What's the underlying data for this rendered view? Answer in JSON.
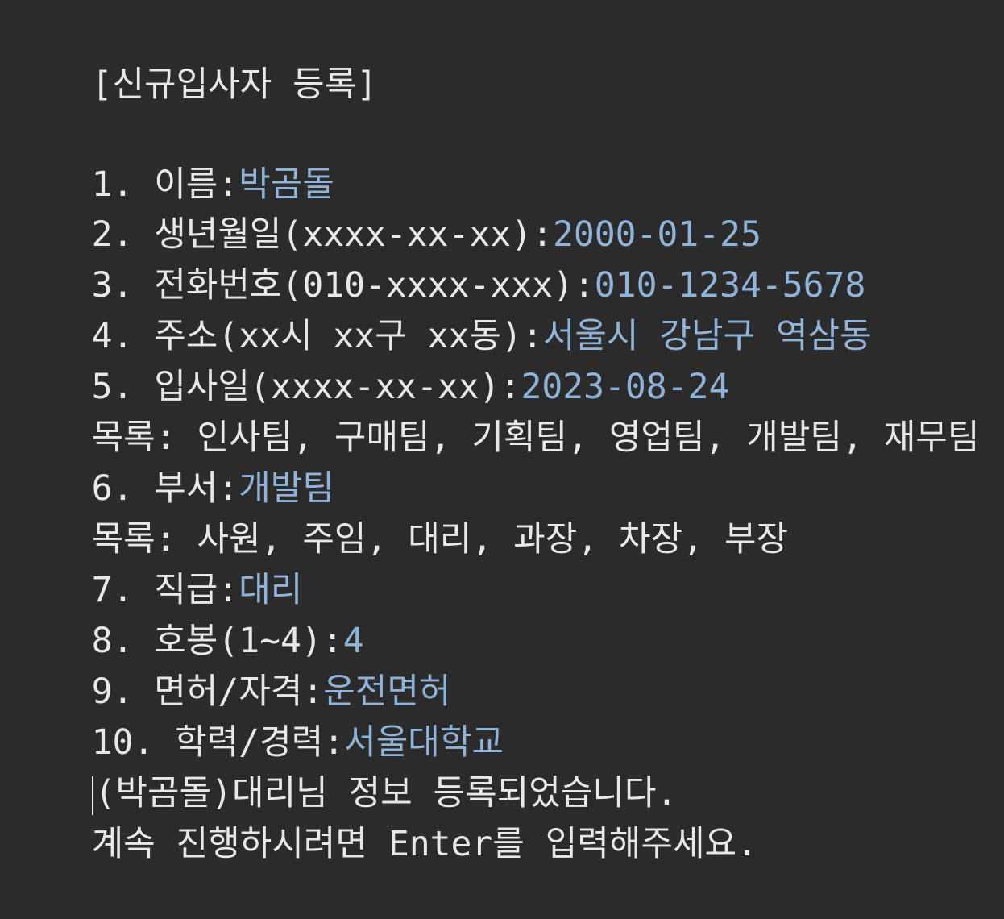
{
  "console": {
    "title": "[신규입사자 등록]",
    "fields": [
      {
        "prompt": "1. 이름:",
        "value": "박곰돌"
      },
      {
        "prompt": "2. 생년월일(xxxx-xx-xx):",
        "value": "2000-01-25"
      },
      {
        "prompt": "3. 전화번호(010-xxxx-xxx):",
        "value": "010-1234-5678"
      },
      {
        "prompt": "4. 주소(xx시 xx구 xx동):",
        "value": "서울시 강남구 역삼동"
      },
      {
        "prompt": "5. 입사일(xxxx-xx-xx):",
        "value": "2023-08-24"
      }
    ],
    "dept_list": "목록: 인사팀, 구매팀, 기획팀, 영업팀, 개발팀, 재무팀",
    "dept_field": {
      "prompt": "6. 부서:",
      "value": "개발팀"
    },
    "rank_list": "목록: 사원, 주임, 대리, 과장, 차장, 부장",
    "fields2": [
      {
        "prompt": "7. 직급:",
        "value": "대리"
      },
      {
        "prompt": "8. 호봉(1~4):",
        "value": "4"
      },
      {
        "prompt": "9. 면허/자격:",
        "value": "운전면허"
      },
      {
        "prompt": "10. 학력/경력:",
        "value": "서울대학교"
      }
    ],
    "result_message": "(박곰돌)대리님 정보 등록되었습니다.",
    "continue_message": "계속 진행하시려면 Enter를 입력해주세요."
  },
  "colors": {
    "background": "#2b2b2b",
    "text": "#e8e8e8",
    "input": "#8fb3d9"
  }
}
